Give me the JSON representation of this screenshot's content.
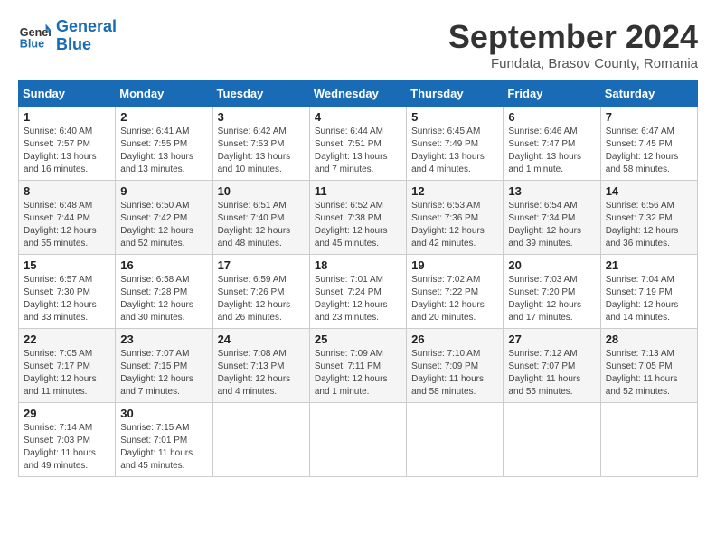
{
  "header": {
    "logo_line1": "General",
    "logo_line2": "Blue",
    "month": "September 2024",
    "location": "Fundata, Brasov County, Romania"
  },
  "weekdays": [
    "Sunday",
    "Monday",
    "Tuesday",
    "Wednesday",
    "Thursday",
    "Friday",
    "Saturday"
  ],
  "weeks": [
    [
      {
        "day": "1",
        "info": "Sunrise: 6:40 AM\nSunset: 7:57 PM\nDaylight: 13 hours\nand 16 minutes."
      },
      {
        "day": "2",
        "info": "Sunrise: 6:41 AM\nSunset: 7:55 PM\nDaylight: 13 hours\nand 13 minutes."
      },
      {
        "day": "3",
        "info": "Sunrise: 6:42 AM\nSunset: 7:53 PM\nDaylight: 13 hours\nand 10 minutes."
      },
      {
        "day": "4",
        "info": "Sunrise: 6:44 AM\nSunset: 7:51 PM\nDaylight: 13 hours\nand 7 minutes."
      },
      {
        "day": "5",
        "info": "Sunrise: 6:45 AM\nSunset: 7:49 PM\nDaylight: 13 hours\nand 4 minutes."
      },
      {
        "day": "6",
        "info": "Sunrise: 6:46 AM\nSunset: 7:47 PM\nDaylight: 13 hours\nand 1 minute."
      },
      {
        "day": "7",
        "info": "Sunrise: 6:47 AM\nSunset: 7:45 PM\nDaylight: 12 hours\nand 58 minutes."
      }
    ],
    [
      {
        "day": "8",
        "info": "Sunrise: 6:48 AM\nSunset: 7:44 PM\nDaylight: 12 hours\nand 55 minutes."
      },
      {
        "day": "9",
        "info": "Sunrise: 6:50 AM\nSunset: 7:42 PM\nDaylight: 12 hours\nand 52 minutes."
      },
      {
        "day": "10",
        "info": "Sunrise: 6:51 AM\nSunset: 7:40 PM\nDaylight: 12 hours\nand 48 minutes."
      },
      {
        "day": "11",
        "info": "Sunrise: 6:52 AM\nSunset: 7:38 PM\nDaylight: 12 hours\nand 45 minutes."
      },
      {
        "day": "12",
        "info": "Sunrise: 6:53 AM\nSunset: 7:36 PM\nDaylight: 12 hours\nand 42 minutes."
      },
      {
        "day": "13",
        "info": "Sunrise: 6:54 AM\nSunset: 7:34 PM\nDaylight: 12 hours\nand 39 minutes."
      },
      {
        "day": "14",
        "info": "Sunrise: 6:56 AM\nSunset: 7:32 PM\nDaylight: 12 hours\nand 36 minutes."
      }
    ],
    [
      {
        "day": "15",
        "info": "Sunrise: 6:57 AM\nSunset: 7:30 PM\nDaylight: 12 hours\nand 33 minutes."
      },
      {
        "day": "16",
        "info": "Sunrise: 6:58 AM\nSunset: 7:28 PM\nDaylight: 12 hours\nand 30 minutes."
      },
      {
        "day": "17",
        "info": "Sunrise: 6:59 AM\nSunset: 7:26 PM\nDaylight: 12 hours\nand 26 minutes."
      },
      {
        "day": "18",
        "info": "Sunrise: 7:01 AM\nSunset: 7:24 PM\nDaylight: 12 hours\nand 23 minutes."
      },
      {
        "day": "19",
        "info": "Sunrise: 7:02 AM\nSunset: 7:22 PM\nDaylight: 12 hours\nand 20 minutes."
      },
      {
        "day": "20",
        "info": "Sunrise: 7:03 AM\nSunset: 7:20 PM\nDaylight: 12 hours\nand 17 minutes."
      },
      {
        "day": "21",
        "info": "Sunrise: 7:04 AM\nSunset: 7:19 PM\nDaylight: 12 hours\nand 14 minutes."
      }
    ],
    [
      {
        "day": "22",
        "info": "Sunrise: 7:05 AM\nSunset: 7:17 PM\nDaylight: 12 hours\nand 11 minutes."
      },
      {
        "day": "23",
        "info": "Sunrise: 7:07 AM\nSunset: 7:15 PM\nDaylight: 12 hours\nand 7 minutes."
      },
      {
        "day": "24",
        "info": "Sunrise: 7:08 AM\nSunset: 7:13 PM\nDaylight: 12 hours\nand 4 minutes."
      },
      {
        "day": "25",
        "info": "Sunrise: 7:09 AM\nSunset: 7:11 PM\nDaylight: 12 hours\nand 1 minute."
      },
      {
        "day": "26",
        "info": "Sunrise: 7:10 AM\nSunset: 7:09 PM\nDaylight: 11 hours\nand 58 minutes."
      },
      {
        "day": "27",
        "info": "Sunrise: 7:12 AM\nSunset: 7:07 PM\nDaylight: 11 hours\nand 55 minutes."
      },
      {
        "day": "28",
        "info": "Sunrise: 7:13 AM\nSunset: 7:05 PM\nDaylight: 11 hours\nand 52 minutes."
      }
    ],
    [
      {
        "day": "29",
        "info": "Sunrise: 7:14 AM\nSunset: 7:03 PM\nDaylight: 11 hours\nand 49 minutes."
      },
      {
        "day": "30",
        "info": "Sunrise: 7:15 AM\nSunset: 7:01 PM\nDaylight: 11 hours\nand 45 minutes."
      },
      {
        "day": "",
        "info": ""
      },
      {
        "day": "",
        "info": ""
      },
      {
        "day": "",
        "info": ""
      },
      {
        "day": "",
        "info": ""
      },
      {
        "day": "",
        "info": ""
      }
    ]
  ]
}
